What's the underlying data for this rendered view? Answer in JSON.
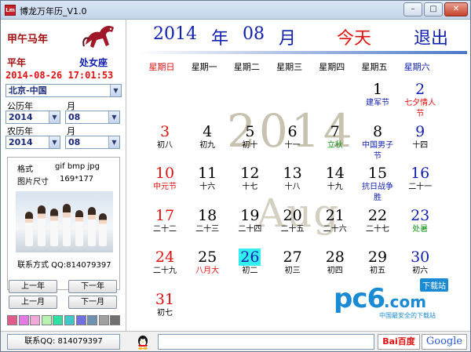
{
  "window": {
    "title": "博龙万年历_V1.0",
    "icon_text": "Lm",
    "minimize": "–",
    "maximize": "□",
    "close": "✕"
  },
  "sidebar": {
    "ganzhi": "甲午马年",
    "year_type": "平年",
    "zodiac_sign": "处女座",
    "datetime": "2014-08-26 17:01:53",
    "city": "北京-中国",
    "gregorian_label": "公历年",
    "gregorian_year": "2014",
    "month_label": "月",
    "gregorian_month": "08",
    "lunar_label": "农历年",
    "lunar_year": "2014",
    "lunar_month_label": "月",
    "lunar_month": "08",
    "info": {
      "format_label": "格式",
      "formats": "gif bmp jpg",
      "size_label": "图片尺寸",
      "size_value": "169*177",
      "contact": "联系方式 QQ:814079397"
    },
    "buttons": {
      "prev_year": "上一年",
      "next_year": "下一年",
      "prev_month": "上一月",
      "next_month": "下一月"
    },
    "swatches": [
      "#e05a8a",
      "#e47ae6",
      "#f0a8d8",
      "#b8f0b0",
      "#30e0a0",
      "#40c8c8",
      "#7070e0",
      "#7090b0",
      "#a0a0a0",
      "#707070"
    ]
  },
  "header": {
    "year": "2014",
    "year_unit": "年",
    "month": "08",
    "month_unit": "月",
    "today_btn": "今天",
    "exit_btn": "退出"
  },
  "weekdays": [
    "星期日",
    "星期一",
    "星期二",
    "星期三",
    "星期四",
    "星期五",
    "星期六"
  ],
  "watermark": {
    "year": "2014",
    "month": "Aug"
  },
  "calendar": [
    {
      "day": "1",
      "sub": "建军节",
      "col": 5,
      "row": 0,
      "dc": "blk",
      "sc": "blu"
    },
    {
      "day": "2",
      "sub": "七夕情人节",
      "col": 6,
      "row": 0,
      "dc": "blu",
      "sc": "red"
    },
    {
      "day": "3",
      "sub": "初八",
      "col": 0,
      "row": 1,
      "dc": "red",
      "sc": ""
    },
    {
      "day": "4",
      "sub": "初九",
      "col": 1,
      "row": 1,
      "dc": "blk",
      "sc": ""
    },
    {
      "day": "5",
      "sub": "初十",
      "col": 2,
      "row": 1,
      "dc": "blk",
      "sc": ""
    },
    {
      "day": "6",
      "sub": "十一",
      "col": 3,
      "row": 1,
      "dc": "blk",
      "sc": ""
    },
    {
      "day": "7",
      "sub": "立秋",
      "col": 4,
      "row": 1,
      "dc": "blk",
      "sc": "grn"
    },
    {
      "day": "8",
      "sub": "中国男子节",
      "col": 5,
      "row": 1,
      "dc": "blk",
      "sc": "blu"
    },
    {
      "day": "9",
      "sub": "十四",
      "col": 6,
      "row": 1,
      "dc": "blu",
      "sc": ""
    },
    {
      "day": "10",
      "sub": "中元节",
      "col": 0,
      "row": 2,
      "dc": "red",
      "sc": "red"
    },
    {
      "day": "11",
      "sub": "十六",
      "col": 1,
      "row": 2,
      "dc": "blk",
      "sc": ""
    },
    {
      "day": "12",
      "sub": "十七",
      "col": 2,
      "row": 2,
      "dc": "blk",
      "sc": ""
    },
    {
      "day": "13",
      "sub": "十八",
      "col": 3,
      "row": 2,
      "dc": "blk",
      "sc": ""
    },
    {
      "day": "14",
      "sub": "十九",
      "col": 4,
      "row": 2,
      "dc": "blk",
      "sc": ""
    },
    {
      "day": "15",
      "sub": "抗日战争胜",
      "col": 5,
      "row": 2,
      "dc": "blk",
      "sc": "blu"
    },
    {
      "day": "16",
      "sub": "二十一",
      "col": 6,
      "row": 2,
      "dc": "blu",
      "sc": ""
    },
    {
      "day": "17",
      "sub": "二十二",
      "col": 0,
      "row": 3,
      "dc": "red",
      "sc": ""
    },
    {
      "day": "18",
      "sub": "二十三",
      "col": 1,
      "row": 3,
      "dc": "blk",
      "sc": ""
    },
    {
      "day": "19",
      "sub": "二十四",
      "col": 2,
      "row": 3,
      "dc": "blk",
      "sc": ""
    },
    {
      "day": "20",
      "sub": "二十五",
      "col": 3,
      "row": 3,
      "dc": "blk",
      "sc": ""
    },
    {
      "day": "21",
      "sub": "二十六",
      "col": 4,
      "row": 3,
      "dc": "blk",
      "sc": ""
    },
    {
      "day": "22",
      "sub": "二十七",
      "col": 5,
      "row": 3,
      "dc": "blk",
      "sc": ""
    },
    {
      "day": "23",
      "sub": "处暑",
      "col": 6,
      "row": 3,
      "dc": "blu",
      "sc": "grn"
    },
    {
      "day": "24",
      "sub": "二十九",
      "col": 0,
      "row": 4,
      "dc": "red",
      "sc": ""
    },
    {
      "day": "25",
      "sub": "八月大",
      "col": 1,
      "row": 4,
      "dc": "blk",
      "sc": "red"
    },
    {
      "day": "26",
      "sub": "初二",
      "col": 2,
      "row": 4,
      "dc": "blu",
      "sc": "",
      "today": true
    },
    {
      "day": "27",
      "sub": "初三",
      "col": 3,
      "row": 4,
      "dc": "blk",
      "sc": ""
    },
    {
      "day": "28",
      "sub": "初四",
      "col": 4,
      "row": 4,
      "dc": "blk",
      "sc": ""
    },
    {
      "day": "29",
      "sub": "初五",
      "col": 5,
      "row": 4,
      "dc": "blk",
      "sc": ""
    },
    {
      "day": "30",
      "sub": "初六",
      "col": 6,
      "row": 4,
      "dc": "blu",
      "sc": ""
    },
    {
      "day": "31",
      "sub": "初七",
      "col": 0,
      "row": 5,
      "dc": "red",
      "sc": ""
    }
  ],
  "logo": {
    "brand": "pc6",
    "dotcom": ".com",
    "badge": "下载站",
    "slogan": "中国最安全的下载站"
  },
  "bottom": {
    "qq_contact": "联系QQ: 814079397",
    "baidu": "Bai百度",
    "google": "Google"
  }
}
